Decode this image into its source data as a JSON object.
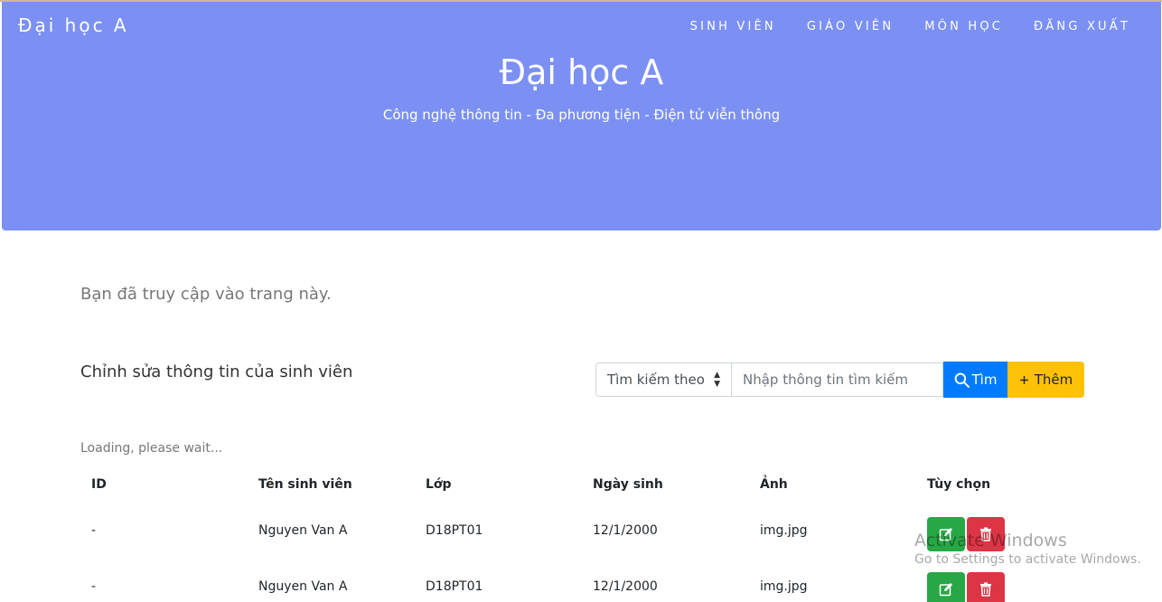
{
  "header": {
    "brand": "Đại học A",
    "nav": [
      "SINH VIÊN",
      "GIÁO VIÊN",
      "MÔN HỌC",
      "ĐĂNG XUẤT"
    ],
    "title": "Đại học A",
    "subtitle": "Công nghệ thông tin - Đa phương tiện - Điện tử viễn thông"
  },
  "main": {
    "notice": "Bạn đã truy cập vào trang này.",
    "section_title": "Chỉnh sửa thông tin của sinh viên",
    "search": {
      "select_value": "Tìm kiếm theo",
      "placeholder": "Nhập thông tin tìm kiếm",
      "search_label": "Tìm",
      "add_label": "Thêm"
    },
    "loading": "Loading, please wait..."
  },
  "table": {
    "headers": [
      "ID",
      "Tên sinh viên",
      "Lớp",
      "Ngày sinh",
      "Ảnh",
      "Tùy chọn"
    ],
    "rows": [
      [
        "-",
        "Nguyen Van A",
        "D18PT01",
        "12/1/2000",
        "img.jpg"
      ],
      [
        "-",
        "Nguyen Van A",
        "D18PT01",
        "12/1/2000",
        "img.jpg"
      ]
    ]
  },
  "watermark": {
    "title": "Activate Windows",
    "subtitle": "Go to Settings to activate Windows."
  },
  "colors": {
    "hero": "#7b90f2",
    "search_button": "#007bff",
    "add_button": "#ffc107",
    "edit_button": "#28a745",
    "delete_button": "#dc3545"
  },
  "icons": [
    "search-icon",
    "plus-icon",
    "edit-icon",
    "trash-icon"
  ]
}
